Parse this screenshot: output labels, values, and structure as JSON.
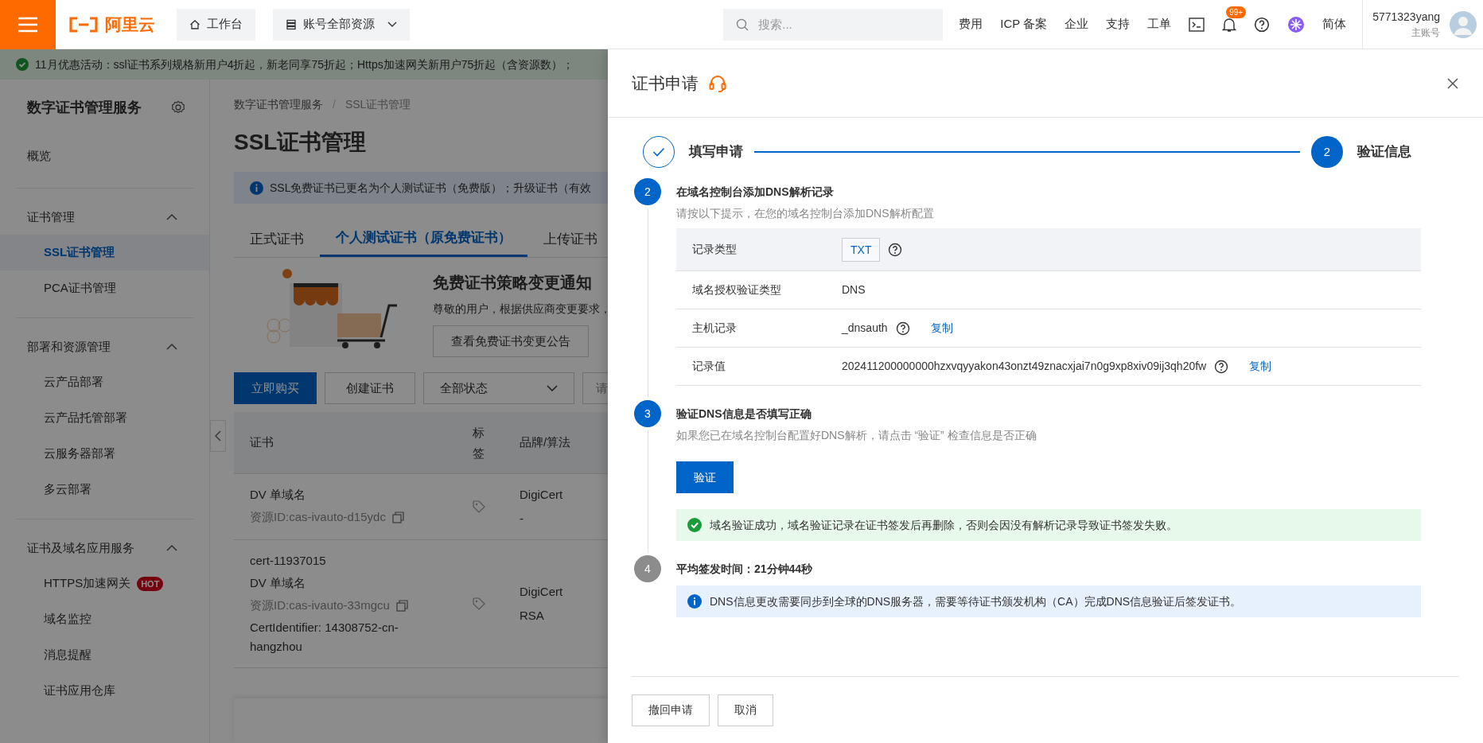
{
  "topbar": {
    "logo": "阿里云",
    "nav": [
      {
        "kind": "home",
        "label": "工作台"
      },
      {
        "kind": "resources",
        "label": "账号全部资源"
      }
    ],
    "search": {
      "placeholder": "搜索..."
    },
    "links": [
      "费用",
      "ICP 备案",
      "企业",
      "支持",
      "工单"
    ],
    "notification_badge": "99+",
    "language": "简体",
    "user": {
      "name": "5771323yang",
      "role": "主账号"
    }
  },
  "promo_banner": "11月优惠活动：ssl证书系列规格新用户4折起，新老同享75折起；Https加速网关新用户75折起（含资源数）；",
  "sidebar": {
    "title": "数字证书管理服务",
    "items": [
      {
        "kind": "link",
        "label": "概览"
      },
      {
        "kind": "group",
        "label": "证书管理",
        "expanded": true,
        "children": [
          {
            "label": "SSL证书管理",
            "selected": true
          },
          {
            "label": "PCA证书管理",
            "selected": false
          }
        ]
      },
      {
        "kind": "group",
        "label": "部署和资源管理",
        "expanded": true,
        "children": [
          {
            "label": "云产品部署",
            "selected": false
          },
          {
            "label": "云产品托管部署",
            "selected": false
          },
          {
            "label": "云服务器部署",
            "selected": false
          },
          {
            "label": "多云部署",
            "selected": false
          }
        ]
      },
      {
        "kind": "group",
        "label": "证书及域名应用服务",
        "expanded": true,
        "children": [
          {
            "label": "HTTPS加速网关",
            "badge": "HOT",
            "selected": false
          },
          {
            "label": "域名监控",
            "selected": false
          },
          {
            "label": "消息提醒",
            "selected": false
          },
          {
            "label": "证书应用仓库",
            "selected": false
          }
        ]
      }
    ]
  },
  "breadcrumb": [
    "数字证书管理服务",
    "SSL证书管理"
  ],
  "breadcrumb_separator": "/",
  "page_title": "SSL证书管理",
  "notice": "SSL免费证书已更名为个人测试证书（免费版）；升级证书（有效",
  "tabs": [
    {
      "label": "正式证书",
      "selected": false
    },
    {
      "label": "个人测试证书（原免费证书）",
      "selected": true
    },
    {
      "label": "上传证书",
      "selected": false
    }
  ],
  "promo_card": {
    "title": "免费证书策略变更通知",
    "text": "尊敬的用户，根据供应商变更要求，",
    "button": "查看免费证书变更公告"
  },
  "toolbar": {
    "buttons": [
      {
        "label": "立即购买",
        "primary": true
      },
      {
        "label": "创建证书",
        "primary": false
      }
    ],
    "status_select": "全部状态",
    "search_placeholder": "请"
  },
  "table": {
    "columns": [
      "证书",
      "标签",
      "品牌/算法"
    ],
    "rows": [
      {
        "cert_lines": [
          "DV 单域名"
        ],
        "resource_id": "资源ID:cas-ivauto-d15ydc",
        "extra_lines": [],
        "brand": [
          "DigiCert",
          "-"
        ]
      },
      {
        "cert_lines": [
          "cert-11937015",
          "DV 单域名"
        ],
        "resource_id": "资源ID:cas-ivauto-33mgcu",
        "extra_lines": [
          "CertIdentifier: 14308752-cn-hangzhou"
        ],
        "brand": [
          "DigiCert",
          "RSA"
        ]
      }
    ]
  },
  "drawer": {
    "title": "证书申请",
    "steps": [
      {
        "done": true,
        "label": "填写申请"
      },
      {
        "done": false,
        "number": "2",
        "label": "验证信息"
      }
    ],
    "sections": [
      {
        "kind": "records",
        "number": "2",
        "active": true,
        "title": "在域名控制台添加DNS解析记录",
        "description": "请按以下提示，在您的域名控制台添加DNS解析配置",
        "records": [
          {
            "label": "记录类型",
            "value": "TXT",
            "tag": true,
            "help": true,
            "highlighted": true
          },
          {
            "label": "域名授权验证类型",
            "value": "DNS",
            "tag": false,
            "help": false,
            "highlighted": false
          },
          {
            "label": "主机记录",
            "value": "_dnsauth",
            "tag": false,
            "help": true,
            "copy": "复制",
            "highlighted": false
          },
          {
            "label": "记录值",
            "value": "202411200000000hzxvqyyakon43onzt49znacxjai7n0g9xp8xiv09ij3qh20fw",
            "tag": false,
            "help": true,
            "copy": "复制",
            "highlighted": false
          }
        ]
      },
      {
        "kind": "verify",
        "number": "3",
        "active": true,
        "title": "验证DNS信息是否填写正确",
        "description": "如果您已在域名控制台配置好DNS解析，请点击 “验证” 检查信息是否正确",
        "button": "验证",
        "success_alert": "域名验证成功，域名验证记录在证书签发后再删除，否则会因没有解析记录导致证书签发失败。"
      },
      {
        "kind": "info",
        "number": "4",
        "active": false,
        "title": "平均签发时间：21分钟44秒",
        "info_alert": "DNS信息更改需要同步到全球的DNS服务器，需要等待证书颁发机构（CA）完成DNS信息验证后签发证书。"
      }
    ],
    "footer_buttons": [
      "撤回申请",
      "取消"
    ]
  }
}
